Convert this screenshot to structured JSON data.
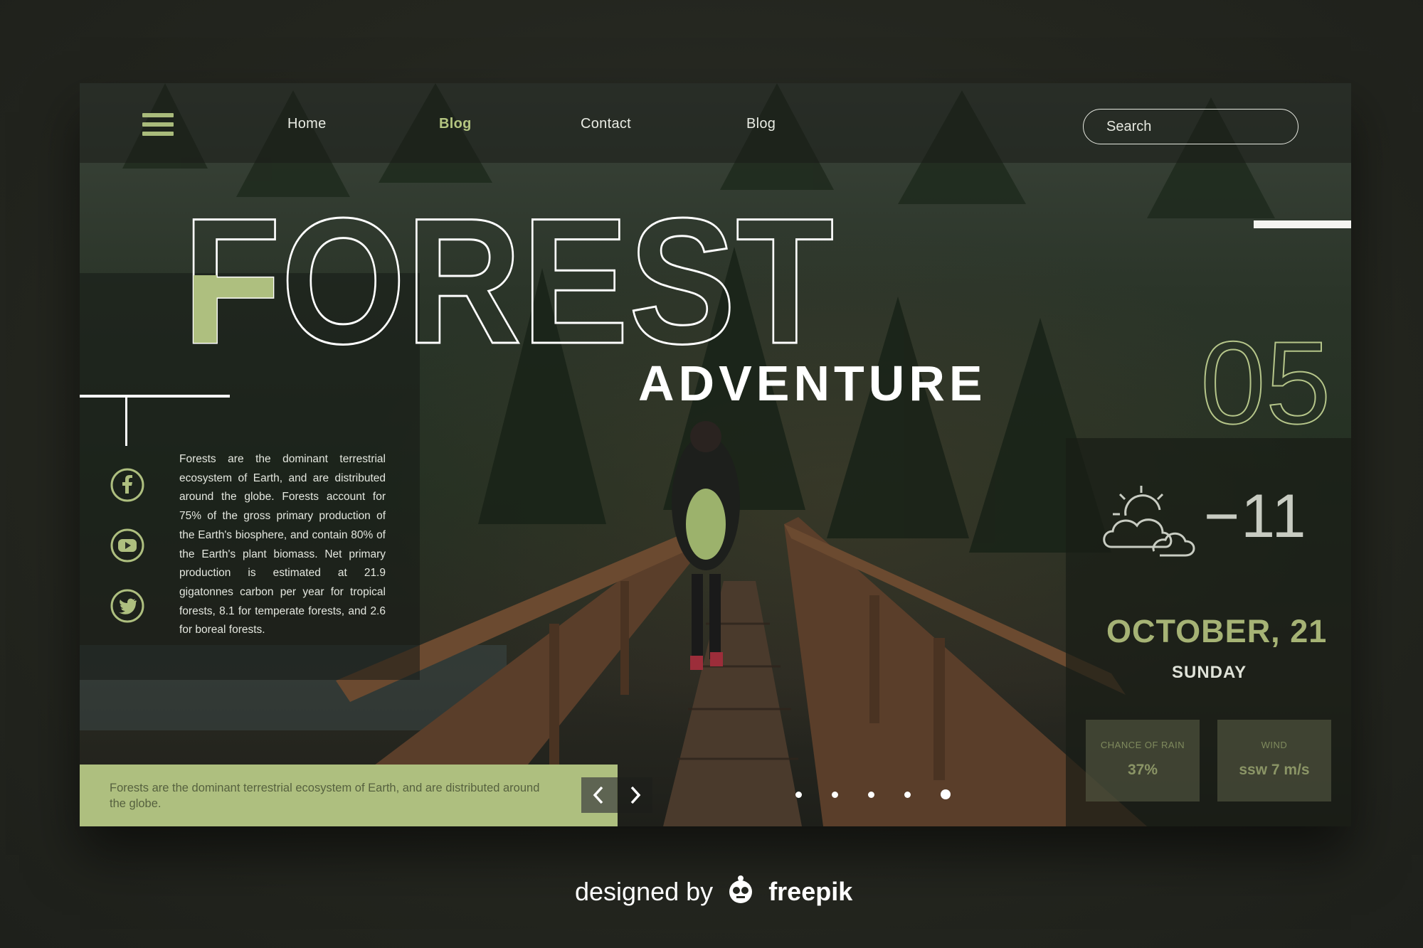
{
  "nav": {
    "links": [
      "Home",
      "Blog",
      "Contact",
      "Blog"
    ],
    "active_index": 1,
    "search_placeholder": "Search"
  },
  "hero": {
    "title": "FOREST",
    "subtitle": "ADVENTURE"
  },
  "intro": {
    "text": "Forests are the dominant terrestrial ecosystem of Earth, and are distributed around the globe. Forests account for 75% of the gross primary production of the Earth's biosphere, and contain 80% of the Earth's plant biomass. Net primary production is estimated at 21.9 gigatonnes carbon per year for tropical forests, 8.1 for temperate forests, and 2.6 for boreal forests."
  },
  "social": {
    "icons": [
      "facebook-icon",
      "youtube-icon",
      "twitter-icon"
    ]
  },
  "caption": {
    "text": "Forests are the dominant terrestrial ecosystem of Earth, and are distributed around the globe."
  },
  "slider": {
    "dot_count": 5,
    "active_dot": 4,
    "prev_icon": "chevron-left-icon",
    "next_icon": "chevron-right-icon"
  },
  "weather": {
    "day_number": "05",
    "icon": "partly-cloudy-icon",
    "temperature": "−11",
    "date": "OCTOBER, 21",
    "weekday": "SUNDAY",
    "rain_label": "CHANCE OF RAIN",
    "rain_value": "37%",
    "wind_label": "WIND",
    "wind_value": "ssw 7 m/s"
  },
  "footer": {
    "prefix": "designed by",
    "brand": "freepik"
  },
  "colors": {
    "accent_green": "#aebf7f",
    "background": "#24261f",
    "text_light": "#e4e7df"
  }
}
